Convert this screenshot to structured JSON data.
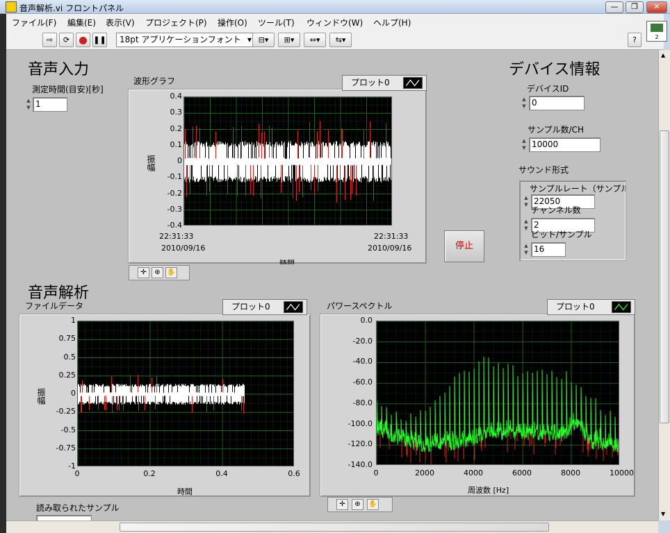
{
  "window": {
    "title": "音声解析.vi フロントパネル",
    "min_label": "—",
    "restore_label": "❐",
    "close_label": "✕"
  },
  "menu": [
    "ファイル(F)",
    "編集(E)",
    "表示(V)",
    "プロジェクト(P)",
    "操作(O)",
    "ツール(T)",
    "ウィンドウ(W)",
    "ヘルプ(H)"
  ],
  "toolbar": {
    "font_select": "18pt アプリケーションフォント",
    "help_label": "?",
    "vi_icon_text": "2"
  },
  "input_section": {
    "heading": "音声入力",
    "duration_label": "測定時間(目安)[秒]",
    "duration_value": "1"
  },
  "waveform_graph": {
    "label": "波形グラフ",
    "legend": "プロット0",
    "y_ticks": [
      "0.4",
      "0.3",
      "0.2",
      "0.1",
      "0",
      "-0.1",
      "-0.2",
      "-0.3",
      "-0.4"
    ],
    "y_label": "振幅",
    "x_label": "時間",
    "x_left_time": "22:31:33",
    "x_left_date": "2010/09/16",
    "x_right_time": "22:31:33",
    "x_right_date": "2010/09/16"
  },
  "device": {
    "heading": "デバイス情報",
    "id_label": "デバイスID",
    "id_value": "0",
    "samples_label": "サンプル数/CH",
    "samples_value": "10000",
    "sound_format_label": "サウンド形式",
    "rate_label": "サンプルレート（サンプル",
    "rate_value": "22050",
    "channels_label": "チャンネル数",
    "channels_value": "2",
    "bits_label": "ビット/サンプル",
    "bits_value": "16"
  },
  "stop_button": "停止",
  "analysis": {
    "heading": "音声解析",
    "samples_read_label": "読み取られたサンプル"
  },
  "file_graph": {
    "label": "ファイルデータ",
    "legend": "プロット0",
    "y_ticks": [
      "1",
      "0.75",
      "0.5",
      "0.25",
      "0",
      "-0.25",
      "-0.5",
      "-0.75",
      "-1"
    ],
    "x_ticks": [
      "0",
      "0.2",
      "0.4",
      "0.6"
    ],
    "y_label": "振幅",
    "x_label": "時間"
  },
  "spectrum_graph": {
    "label": "パワースペクトル",
    "legend": "プロット0",
    "y_ticks": [
      "0.0",
      "-20.0",
      "-40.0",
      "-60.0",
      "-80.0",
      "-100.0",
      "-120.0",
      "-140.0"
    ],
    "x_ticks": [
      "0",
      "2000",
      "4000",
      "6000",
      "8000",
      "10000"
    ],
    "x_label": "周波数 [Hz]"
  },
  "chart_data": [
    {
      "type": "line",
      "title": "波形グラフ",
      "xlabel": "時間",
      "ylabel": "振幅",
      "ylim": [
        -0.4,
        0.4
      ],
      "grid": true,
      "series": [
        {
          "name": "プロット0",
          "color": "#ffffff",
          "envelope": [
            -0.28,
            0.28
          ]
        }
      ]
    },
    {
      "type": "line",
      "title": "ファイルデータ",
      "xlabel": "時間",
      "ylabel": "振幅",
      "xlim": [
        0,
        0.6
      ],
      "ylim": [
        -1,
        1
      ],
      "grid": true,
      "series": [
        {
          "name": "プロット0",
          "color": "#ffffff",
          "x_end": 0.46,
          "envelope": [
            -0.28,
            0.28
          ]
        }
      ]
    },
    {
      "type": "line",
      "title": "パワースペクトル",
      "xlabel": "周波数 [Hz]",
      "xlim": [
        0,
        10000
      ],
      "ylim": [
        -140,
        0
      ],
      "grid": true,
      "series": [
        {
          "name": "プロット0",
          "color": "#22ff22",
          "x": [
            0,
            500,
            1000,
            2000,
            3000,
            4000,
            4500,
            5000,
            6000,
            7000,
            7500,
            8000,
            8200,
            8800,
            9500,
            10000
          ],
          "peaks": [
            -75,
            -85,
            -95,
            -85,
            -60,
            -45,
            -35,
            -42,
            -50,
            -50,
            -50,
            -55,
            -60,
            -75,
            -88,
            -95
          ],
          "floor": [
            -105,
            -110,
            -115,
            -122,
            -120,
            -115,
            -110,
            -110,
            -110,
            -110,
            -112,
            -108,
            -100,
            -118,
            -120,
            -122
          ]
        }
      ]
    }
  ],
  "colors": {
    "panel": "#c0c0c0",
    "plot_bg": "#000000",
    "grid": "#1c6b1c",
    "white_trace": "#ffffff",
    "red_trace": "#e02020",
    "green_trace": "#22ff22",
    "stop_text": "#d00000"
  }
}
